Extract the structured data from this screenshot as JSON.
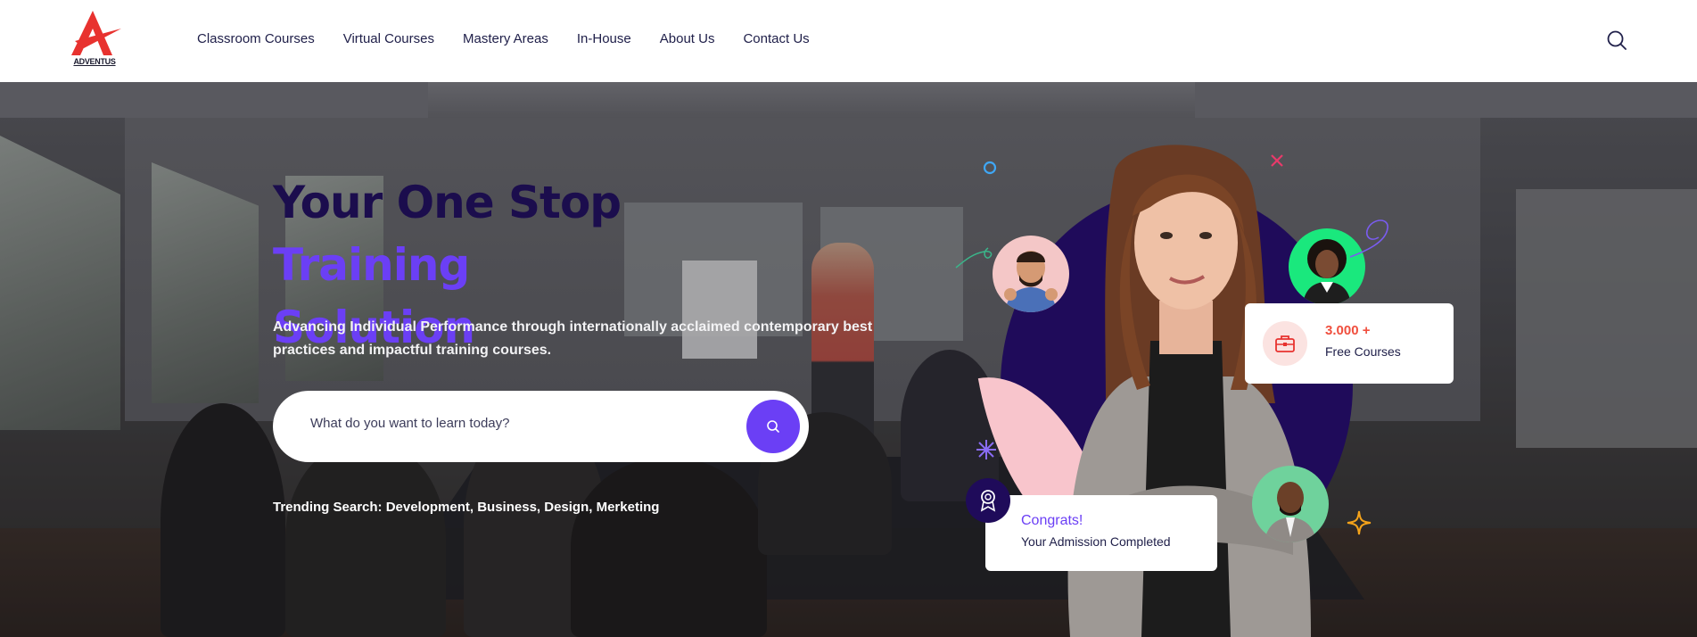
{
  "brand": {
    "logo_text": "ADVENTUS",
    "accent": "#e8322f"
  },
  "nav": {
    "items": [
      {
        "label": "Classroom Courses"
      },
      {
        "label": "Virtual Courses"
      },
      {
        "label": "Mastery Areas"
      },
      {
        "label": "In-House"
      },
      {
        "label": "About Us"
      },
      {
        "label": "Contact Us"
      }
    ],
    "search_icon": "search-icon"
  },
  "hero": {
    "title_dark": "Your One Stop ",
    "title_purple_1": "Training",
    "title_purple_2": "Solution",
    "subtitle": "Advancing Individual Performance through internationally acclaimed contemporary best practices and impactful training courses.",
    "search_placeholder": "What do you want to learn today?",
    "search_button_icon": "search-icon",
    "trending_label": "Trending Search: Development, Business, Design, Merketing"
  },
  "stats_card": {
    "number": "3.000 +",
    "label": "Free Courses",
    "icon": "briefcase-icon"
  },
  "congrats_card": {
    "title": "Congrats!",
    "subtitle": "Your Admission Completed",
    "icon": "award-icon"
  },
  "colors": {
    "purple": "#6b3ff5",
    "navy": "#1f0b5a",
    "dark_text": "#1b0d4d",
    "coral": "#f04f3e"
  }
}
